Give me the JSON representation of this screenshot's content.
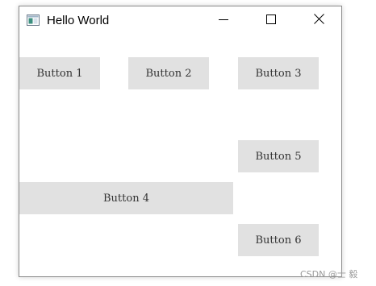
{
  "window": {
    "title": "Hello World",
    "title_icon": "app-window-icon",
    "controls": {
      "minimize_icon": "minimize-icon",
      "maximize_icon": "maximize-icon",
      "close_icon": "close-icon"
    }
  },
  "buttons": {
    "b1": "Button 1",
    "b2": "Button 2",
    "b3": "Button 3",
    "b4": "Button 4",
    "b5": "Button 5",
    "b6": "Button 6"
  },
  "watermark": "CSDN @士 毅",
  "colors": {
    "button_bg": "#e1e1e1",
    "button_text": "#333333",
    "window_border": "#8a8a8a"
  }
}
